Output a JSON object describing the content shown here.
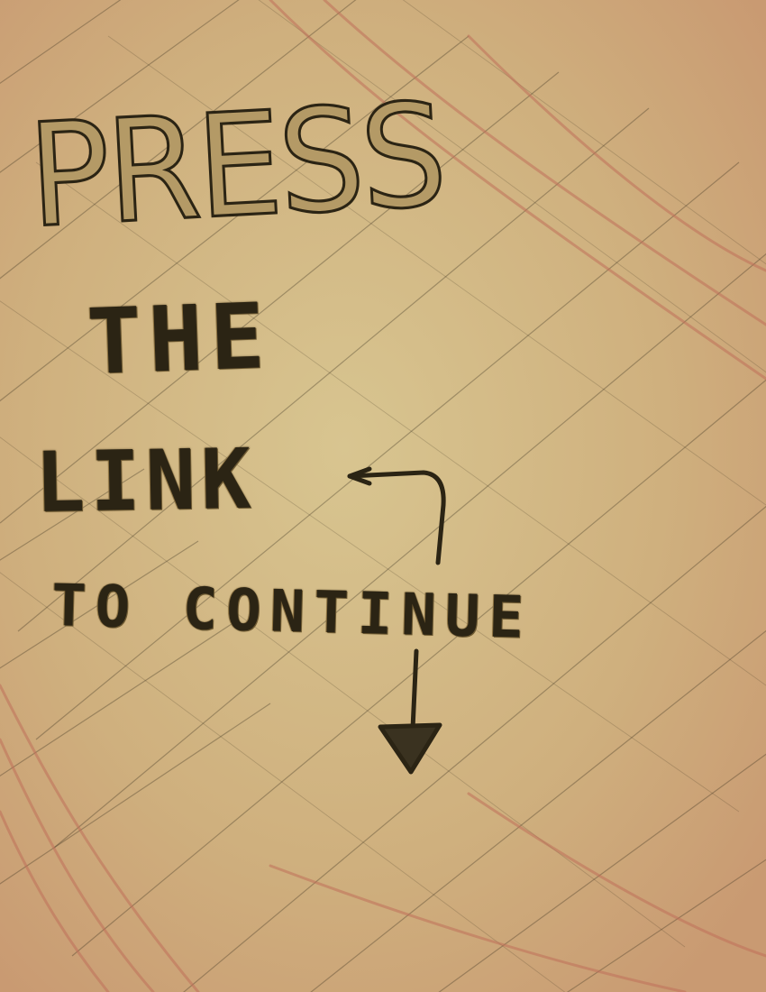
{
  "note": {
    "line1": "PRESS",
    "line2": "THE",
    "line3": "LINK",
    "line4": "TO CONTINUE"
  },
  "colors": {
    "paper": "#cdb37f",
    "ink": "#2b2414",
    "pencil_red": "#c0705a"
  },
  "icons": {
    "bent_arrow": "bent-arrow-icon",
    "down_arrow": "down-arrow-icon"
  }
}
